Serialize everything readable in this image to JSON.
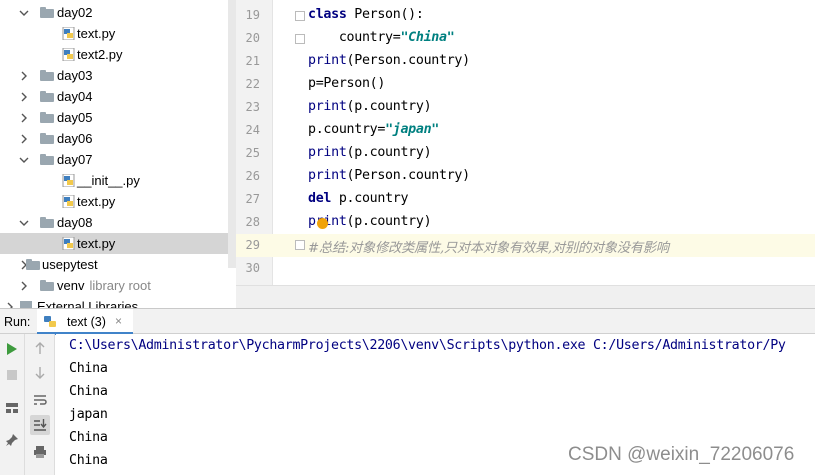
{
  "tree": {
    "items": [
      {
        "label": "day02",
        "type": "folder",
        "expanded": true
      },
      {
        "label": "text.py",
        "type": "file"
      },
      {
        "label": "text2.py",
        "type": "file"
      },
      {
        "label": "day03",
        "type": "folder",
        "expanded": false
      },
      {
        "label": "day04",
        "type": "folder",
        "expanded": false
      },
      {
        "label": "day05",
        "type": "folder",
        "expanded": false
      },
      {
        "label": "day06",
        "type": "folder",
        "expanded": false
      },
      {
        "label": "day07",
        "type": "folder",
        "expanded": true
      },
      {
        "label": "__init__.py",
        "type": "file"
      },
      {
        "label": "text.py",
        "type": "file"
      },
      {
        "label": "day08",
        "type": "folder",
        "expanded": true
      },
      {
        "label": "text.py",
        "type": "file",
        "selected": true
      },
      {
        "label": "usepytest",
        "type": "folder",
        "expanded": false
      },
      {
        "label": "venv",
        "sublabel": "library root",
        "type": "folder",
        "expanded": false
      },
      {
        "label": "External Libraries",
        "type": "library",
        "expanded": false
      }
    ]
  },
  "editor": {
    "line_numbers": [
      "19",
      "20",
      "21",
      "22",
      "23",
      "24",
      "25",
      "26",
      "27",
      "28",
      "29",
      "30"
    ],
    "lines": {
      "l19_kw": "class",
      "l19_rest": " Person():",
      "l20_pre": "    country=",
      "l20_str": "\"China\"",
      "l21_fn": "print",
      "l21_rest": "(Person.country)",
      "l22": "p=Person()",
      "l23_fn": "print",
      "l23_rest": "(p.country)",
      "l24_pre": "p.country=",
      "l24_str": "\"japan\"",
      "l25_fn": "print",
      "l25_rest": "(p.country)",
      "l26_fn": "print",
      "l26_rest": "(Person.country)",
      "l27_kw": "del",
      "l27_rest": " p.country",
      "l28_fn": "print",
      "l28_rest": "(p.country)",
      "l29_cmt": "#总结:对象修改类属性,只对本对象有效果,对别的对象没有影响"
    }
  },
  "run": {
    "title": "Run:",
    "tab_label": "text (3)",
    "tab_close": "×",
    "output": [
      "C:\\Users\\Administrator\\PycharmProjects\\2206\\venv\\Scripts\\python.exe C:/Users/Administrator/Py",
      "China",
      "China",
      "japan",
      "China",
      "China"
    ]
  },
  "watermark": "CSDN @weixin_72206076",
  "colors": {
    "keyword": "#000080",
    "string": "#008080",
    "comment": "#999999",
    "selection": "#d5d5d5",
    "current_line": "#fdfbe6",
    "run_icon": "#3e9b3e",
    "breakpoint": "#f0a30a"
  }
}
